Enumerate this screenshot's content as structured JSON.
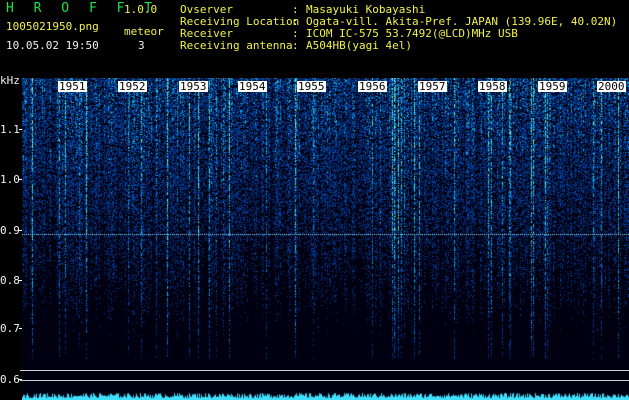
{
  "header": {
    "app_name": "H R O F F T",
    "version": "1.0.0",
    "filename": "1005021950.png",
    "meteor_label": "meteor",
    "datetime": "10.05.02 19:50",
    "meteor_count": "3",
    "info": [
      {
        "label": "Ovserver",
        "value": "Masayuki Kobayashi"
      },
      {
        "label": "Receiving Location",
        "value": "Ogata-vill. Akita-Pref. JAPAN (139.96E, 40.02N)"
      },
      {
        "label": "Receiver",
        "value": "ICOM IC-575 53.7492(@LCD)MHz USB"
      },
      {
        "label": "Receiving antenna",
        "value": "A504HB(yagi 4el)"
      }
    ]
  },
  "axis": {
    "unit": "kHz",
    "y_labels": [
      "1.1",
      "1.0",
      "0.9",
      "0.8",
      "0.7",
      "0.6"
    ],
    "x_labels": [
      "1951",
      "1952",
      "1953",
      "1954",
      "1955",
      "1956",
      "1957",
      "1958",
      "1959",
      "2000"
    ]
  },
  "colors": {
    "text_green": "#19e34a",
    "text_yellow": "#f2f24a",
    "spectrum_bg": "#000010",
    "noise": "#2a5cff",
    "signal": "#5fe0ff"
  }
}
